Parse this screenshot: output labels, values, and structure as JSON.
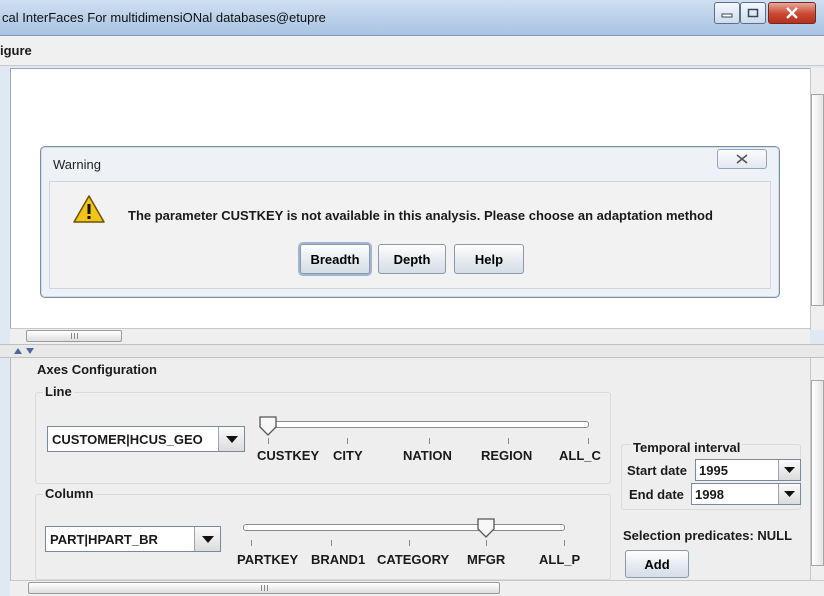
{
  "window": {
    "title": "cal InterFaces For multidimensiONal databases@etupre"
  },
  "menubar": {
    "items": [
      "igure"
    ]
  },
  "dialog": {
    "title": "Warning",
    "message": "The parameter CUSTKEY is not available in this analysis. Please choose an adaptation method",
    "buttons": [
      "Breadth",
      "Depth",
      "Help"
    ],
    "default_button": "Breadth"
  },
  "config": {
    "heading": "Axes Configuration",
    "line": {
      "label": "Line",
      "combo_value": "CUSTOMER|HCUS_GEO",
      "levels": [
        "CUSTKEY",
        "CITY",
        "NATION",
        "REGION",
        "ALL_C"
      ],
      "selected_level": "CUSTKEY"
    },
    "column": {
      "label": "Column",
      "combo_value": "PART|HPART_BR",
      "levels": [
        "PARTKEY",
        "BRAND1",
        "CATEGORY",
        "MFGR",
        "ALL_P"
      ],
      "selected_level": "MFGR"
    },
    "temporal": {
      "label": "Temporal interval",
      "start_label": "Start date",
      "start_value": "1995",
      "end_label": "End date",
      "end_value": "1998"
    },
    "selection": {
      "label": "Selection predicates: NULL",
      "add_button": "Add"
    }
  },
  "colors": {
    "titlebar": "#b9d0ea",
    "close_button": "#c9472f",
    "warning_icon": "#f2c418",
    "dialog_border": "#7b8ea5"
  },
  "icons": [
    "minimize-icon",
    "maximize-icon",
    "close-icon",
    "warning-icon",
    "dropdown-arrow-icon",
    "scroll-arrow-icon"
  ]
}
